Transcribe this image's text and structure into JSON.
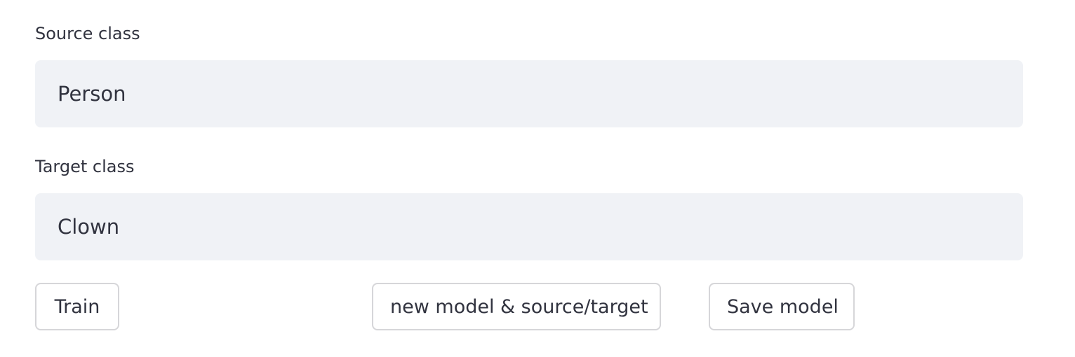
{
  "source": {
    "label": "Source class",
    "value": "Person"
  },
  "target": {
    "label": "Target class",
    "value": "Clown"
  },
  "buttons": {
    "train": "Train",
    "new_model": "new model & source/target",
    "save_model": "Save model"
  }
}
